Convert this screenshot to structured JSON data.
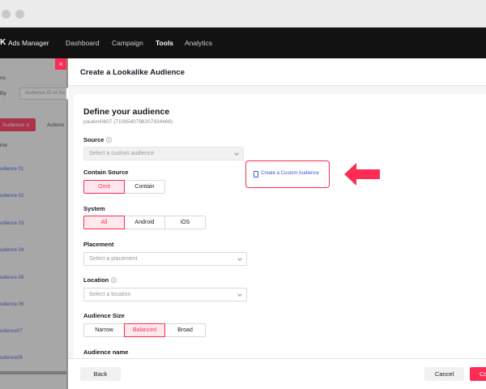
{
  "app": {
    "logo": "K",
    "brand": "Ads Manager",
    "nav": [
      "Dashboard",
      "Campaign",
      "Tools",
      "Analytics"
    ],
    "active_nav": "Tools"
  },
  "background": {
    "close_glyph": "×",
    "label_top": "ns",
    "by_label": "By",
    "search_placeholder": "Audience ID or Na",
    "audience_button": "Audience ∨",
    "actions_label": "Actions",
    "name_header": "me",
    "rows": [
      "udience 01",
      "udience 02",
      "udience 03",
      "udience 04",
      "udience 05",
      "udience 06",
      "udience07",
      "udience08"
    ]
  },
  "modal": {
    "title": "Create a Lookalike Audience",
    "heading": "Define your audience",
    "account": "pauleni0607 (7106540798207934466)",
    "source": {
      "label": "Source",
      "placeholder": "Select a custom audience",
      "create_link": "Create a Custom Audience"
    },
    "contain_source": {
      "label": "Contain Source",
      "options": [
        "Omit",
        "Contain"
      ],
      "selected": "Omit"
    },
    "system": {
      "label": "System",
      "options": [
        "All",
        "Android",
        "iOS"
      ],
      "selected": "All"
    },
    "placement": {
      "label": "Placement",
      "placeholder": "Select a placement"
    },
    "location": {
      "label": "Location",
      "placeholder": "Select a location"
    },
    "audience_size": {
      "label": "Audience Size",
      "options": [
        "Narrow",
        "Balanced",
        "Broad"
      ],
      "selected": "Balanced"
    },
    "audience_name": {
      "label": "Audience name"
    },
    "footer": {
      "back": "Back",
      "cancel": "Cancel",
      "confirm": "Co"
    }
  },
  "colors": {
    "accent": "#fe2c55",
    "link": "#3f55d6",
    "topbar": "#121212"
  }
}
